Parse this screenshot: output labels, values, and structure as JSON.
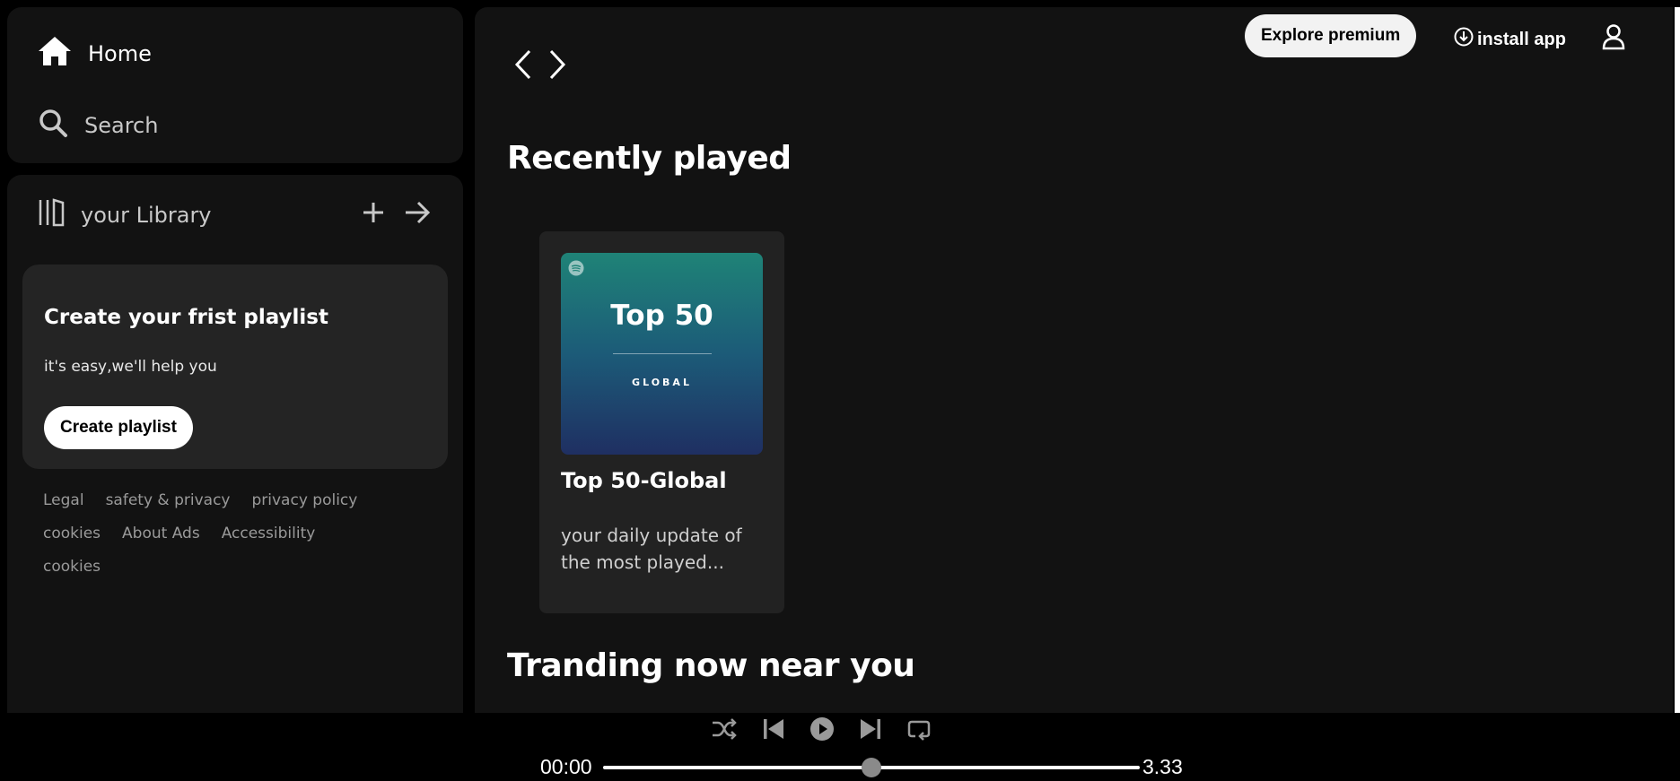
{
  "nav": {
    "home_label": "Home",
    "search_label": "Search"
  },
  "library": {
    "title": "your Library",
    "card": {
      "title": "Create your frist playlist",
      "subtitle": "it's easy,we'll help you",
      "button_label": "Create playlist"
    },
    "footer_links": [
      [
        "Legal",
        "safety & privacy",
        "privacy policy"
      ],
      [
        "cookies",
        "About Ads",
        "Accessibility"
      ],
      [
        "cookies"
      ]
    ]
  },
  "header": {
    "explore_premium_label": "Explore premium",
    "install_app_label": "install app"
  },
  "main": {
    "recently_played_title": "Recently played",
    "trending_title": "Tranding now near you",
    "album": {
      "cover_title": "Top 50",
      "cover_subtitle": "GLOBAL",
      "title": "Top 50-Global",
      "description": "your daily update of the most played..."
    }
  },
  "player": {
    "current_time": "00:00",
    "total_time": "3.33",
    "progress_fraction": 0.5
  },
  "icons": {
    "home": "home-icon",
    "search": "search-icon",
    "library": "library-icon",
    "add": "plus-icon",
    "expand": "arrow-right-icon",
    "back": "chevron-left-icon",
    "forward": "chevron-right-icon",
    "download": "download-circle-icon",
    "user": "user-icon",
    "shuffle": "shuffle-icon",
    "previous": "skip-back-icon",
    "play": "play-icon",
    "next": "skip-forward-icon",
    "repeat": "repeat-icon",
    "spotify": "spotify-logo-icon"
  },
  "colors": {
    "background": "#000000",
    "panel": "#121212",
    "card": "#242424",
    "muted_text": "#9a9a9a",
    "cover_top": "#1f8377",
    "cover_bottom": "#1f2f62"
  }
}
